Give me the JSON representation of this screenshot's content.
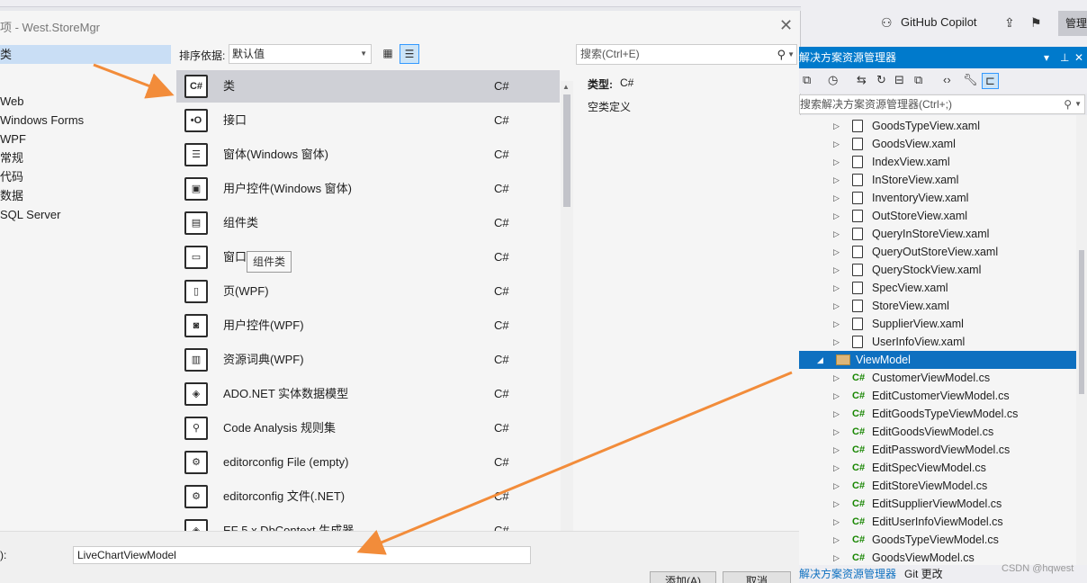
{
  "dialog": {
    "title": "项 - West.StoreMgr",
    "close": "✕"
  },
  "categories": [
    {
      "label": "类",
      "selected": true
    },
    {
      "label": "Web"
    },
    {
      "label": "Windows Forms"
    },
    {
      "label": "WPF"
    },
    {
      "label": "常规"
    },
    {
      "label": "代码"
    },
    {
      "label": "数据"
    },
    {
      "label": "SQL Server"
    }
  ],
  "sort": {
    "label": "排序依据:",
    "value": "默认值"
  },
  "items": [
    {
      "name": "类",
      "lang": "C#",
      "icon": "class-icon",
      "glyph": "C#"
    },
    {
      "name": "接口",
      "lang": "C#",
      "icon": "interface-icon",
      "glyph": "•O"
    },
    {
      "name": "窗体(Windows 窗体)",
      "lang": "C#",
      "icon": "form-icon",
      "glyph": "☰"
    },
    {
      "name": "用户控件(Windows 窗体)",
      "lang": "C#",
      "icon": "usercontrol-icon",
      "glyph": "▣"
    },
    {
      "name": "组件类",
      "lang": "C#",
      "icon": "component-icon",
      "glyph": "▤"
    },
    {
      "name": "窗口",
      "lang": "C#",
      "icon": "window-icon",
      "glyph": "▭"
    },
    {
      "name": "页(WPF)",
      "lang": "C#",
      "icon": "page-icon",
      "glyph": "▯"
    },
    {
      "name": "用户控件(WPF)",
      "lang": "C#",
      "icon": "wpf-usercontrol-icon",
      "glyph": "◙"
    },
    {
      "name": "资源词典(WPF)",
      "lang": "C#",
      "icon": "resource-dictionary-icon",
      "glyph": "▥"
    },
    {
      "name": "ADO.NET 实体数据模型",
      "lang": "C#",
      "icon": "ado-icon",
      "glyph": "◈"
    },
    {
      "name": "Code Analysis 规则集",
      "lang": "C#",
      "icon": "ruleset-icon",
      "glyph": "⚲"
    },
    {
      "name": "editorconfig File (empty)",
      "lang": "C#",
      "icon": "editorconfig-icon",
      "glyph": "⚙"
    },
    {
      "name": "editorconfig 文件(.NET)",
      "lang": "C#",
      "icon": "editorconfig-net-icon",
      "glyph": "⚙"
    },
    {
      "name": "EF 5.x DbContext 生成器",
      "lang": "C#",
      "icon": "ef-icon",
      "glyph": "◈"
    }
  ],
  "tooltip": "组件类",
  "search": {
    "placeholder": "搜索(Ctrl+E)"
  },
  "details": {
    "type_label": "类型:",
    "type_value": "C#",
    "description": "空类定义"
  },
  "name_field": {
    "label": "):",
    "value": "LiveChartViewModel"
  },
  "buttons": {
    "add": "添加(A)",
    "cancel": "取消"
  },
  "vs": {
    "copilot": "GitHub Copilot",
    "manage": "管理"
  },
  "solution_explorer": {
    "title": "解决方案资源管理器",
    "search_placeholder": "搜索解决方案资源管理器(Ctrl+;)",
    "nodes": [
      {
        "text": "GoodsTypeView.xaml",
        "kind": "xaml"
      },
      {
        "text": "GoodsView.xaml",
        "kind": "xaml"
      },
      {
        "text": "IndexView.xaml",
        "kind": "xaml"
      },
      {
        "text": "InStoreView.xaml",
        "kind": "xaml"
      },
      {
        "text": "InventoryView.xaml",
        "kind": "xaml"
      },
      {
        "text": "OutStoreView.xaml",
        "kind": "xaml"
      },
      {
        "text": "QueryInStoreView.xaml",
        "kind": "xaml"
      },
      {
        "text": "QueryOutStoreView.xaml",
        "kind": "xaml"
      },
      {
        "text": "QueryStockView.xaml",
        "kind": "xaml"
      },
      {
        "text": "SpecView.xaml",
        "kind": "xaml"
      },
      {
        "text": "StoreView.xaml",
        "kind": "xaml"
      },
      {
        "text": "SupplierView.xaml",
        "kind": "xaml"
      },
      {
        "text": "UserInfoView.xaml",
        "kind": "xaml"
      },
      {
        "text": "ViewModel",
        "kind": "folder"
      },
      {
        "text": "CustomerViewModel.cs",
        "kind": "cs"
      },
      {
        "text": "EditCustomerViewModel.cs",
        "kind": "cs"
      },
      {
        "text": "EditGoodsTypeViewModel.cs",
        "kind": "cs"
      },
      {
        "text": "EditGoodsViewModel.cs",
        "kind": "cs"
      },
      {
        "text": "EditPasswordViewModel.cs",
        "kind": "cs"
      },
      {
        "text": "EditSpecViewModel.cs",
        "kind": "cs"
      },
      {
        "text": "EditStoreViewModel.cs",
        "kind": "cs"
      },
      {
        "text": "EditSupplierViewModel.cs",
        "kind": "cs"
      },
      {
        "text": "EditUserInfoViewModel.cs",
        "kind": "cs"
      },
      {
        "text": "GoodsTypeViewModel.cs",
        "kind": "cs"
      },
      {
        "text": "GoodsViewModel.cs",
        "kind": "cs"
      }
    ],
    "tabs": [
      "解决方案资源管理器",
      "Git 更改"
    ]
  },
  "watermark": "CSDN @hqwest",
  "colors": {
    "accent": "#007acc",
    "arrow": "#f28c3a",
    "selection": "#0e70c0"
  }
}
